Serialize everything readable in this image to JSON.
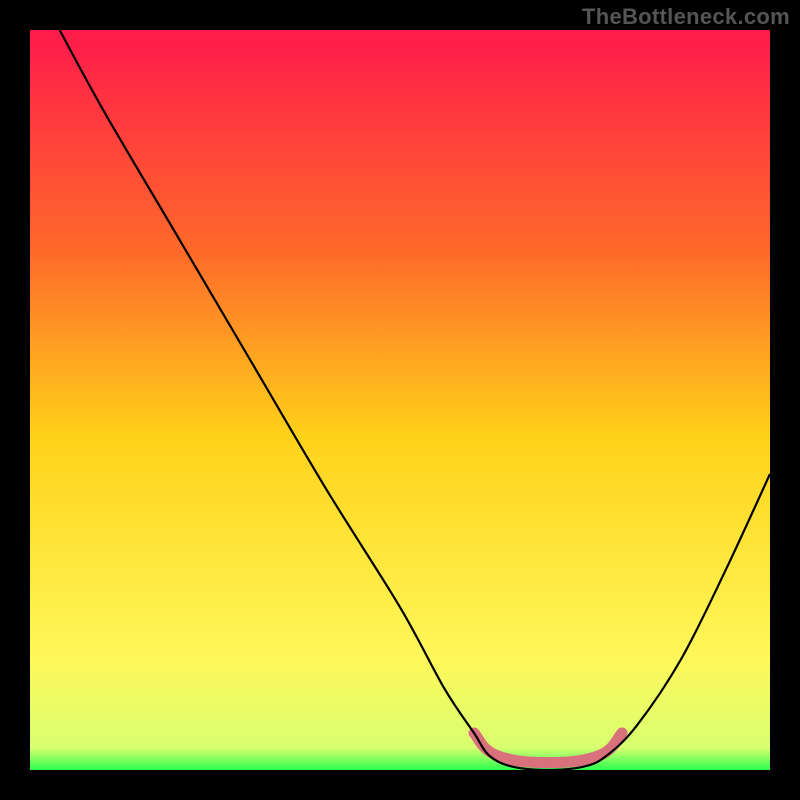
{
  "watermark": "TheBottleneck.com",
  "chart_data": {
    "type": "line",
    "title": "",
    "xlabel": "",
    "ylabel": "",
    "xlim": [
      0,
      100
    ],
    "ylim": [
      0,
      100
    ],
    "gradient_colors": {
      "top": "#ff1a4b",
      "mid_upper": "#ff6a2a",
      "mid": "#ffd21a",
      "mid_lower": "#fff85a",
      "bottom": "#2eff4f"
    },
    "curve_points": [
      {
        "x": 4,
        "y": 100
      },
      {
        "x": 10,
        "y": 89
      },
      {
        "x": 20,
        "y": 72
      },
      {
        "x": 30,
        "y": 55
      },
      {
        "x": 40,
        "y": 38
      },
      {
        "x": 50,
        "y": 22
      },
      {
        "x": 56,
        "y": 11
      },
      {
        "x": 60,
        "y": 5
      },
      {
        "x": 62,
        "y": 2
      },
      {
        "x": 65,
        "y": 0.5
      },
      {
        "x": 70,
        "y": 0
      },
      {
        "x": 75,
        "y": 0.5
      },
      {
        "x": 78,
        "y": 2
      },
      {
        "x": 82,
        "y": 6
      },
      {
        "x": 88,
        "y": 15
      },
      {
        "x": 94,
        "y": 27
      },
      {
        "x": 100,
        "y": 40
      }
    ],
    "marker_band": {
      "x_start": 60,
      "x_end": 80,
      "y": 2,
      "color": "#d9717d"
    }
  }
}
